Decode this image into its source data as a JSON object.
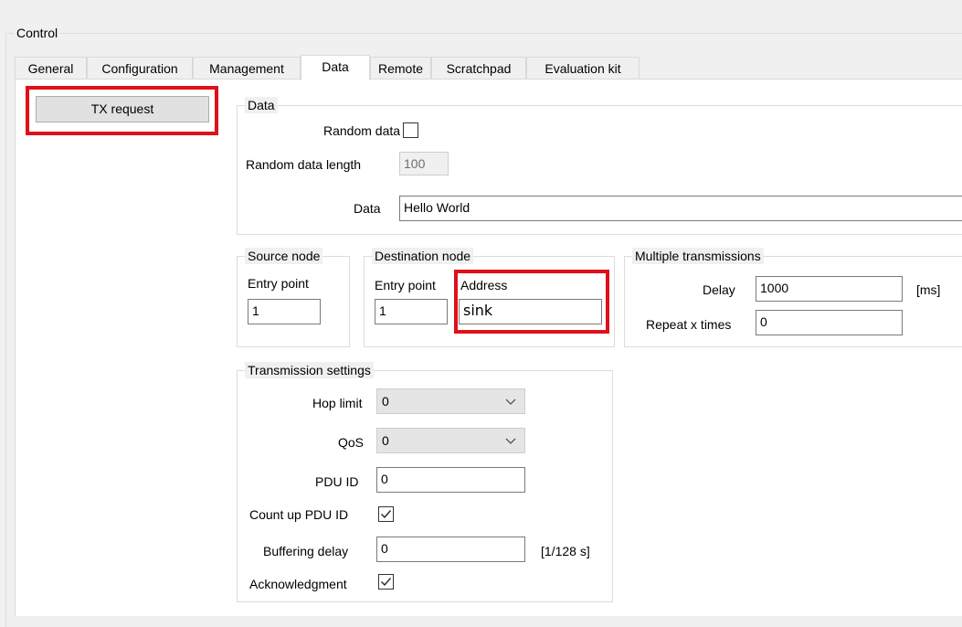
{
  "window": {
    "group_title": "Control"
  },
  "tabs": [
    {
      "label": "General"
    },
    {
      "label": "Configuration"
    },
    {
      "label": "Management"
    },
    {
      "label": "Data",
      "active": true
    },
    {
      "label": "Remote"
    },
    {
      "label": "Scratchpad"
    },
    {
      "label": "Evaluation kit"
    }
  ],
  "tx_button": {
    "label": "TX request"
  },
  "data_group": {
    "title": "Data",
    "random_data_label": "Random data",
    "random_data_checked": false,
    "random_length_label": "Random data length",
    "random_length_value": "100",
    "data_label": "Data",
    "data_value": "Hello World"
  },
  "source_node": {
    "title": "Source node",
    "entry_point_label": "Entry point",
    "entry_point_value": "1"
  },
  "destination_node": {
    "title": "Destination node",
    "entry_point_label": "Entry point",
    "entry_point_value": "1",
    "address_label": "Address",
    "address_value": "sink"
  },
  "multiple": {
    "title": "Multiple transmissions",
    "delay_label": "Delay",
    "delay_value": "1000",
    "delay_unit": "[ms]",
    "repeat_label": "Repeat x times",
    "repeat_value": "0"
  },
  "transmission": {
    "title": "Transmission settings",
    "hop_limit_label": "Hop limit",
    "hop_limit_value": "0",
    "qos_label": "QoS",
    "qos_value": "0",
    "pdu_id_label": "PDU ID",
    "pdu_id_value": "0",
    "count_up_label": "Count up PDU ID",
    "count_up_checked": true,
    "buffering_label": "Buffering delay",
    "buffering_value": "0",
    "buffering_unit": "[1/128 s]",
    "ack_label": "Acknowledgment",
    "ack_checked": true
  },
  "colors": {
    "highlight": "#e0101a",
    "panel": "#ffffff",
    "background": "#f0f0f0"
  }
}
